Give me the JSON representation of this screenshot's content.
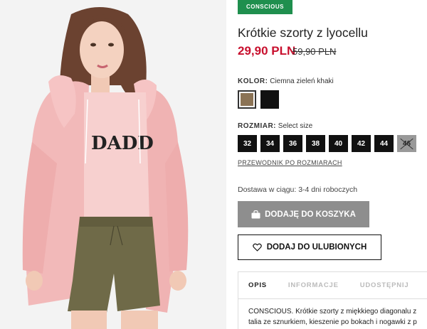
{
  "badge": "CONSCIOUS",
  "product": {
    "title": "Krótkie szorty z lyocellu",
    "price": "29,90 PLN",
    "old_price": "59,90 PLN",
    "image_print": "DADD"
  },
  "color": {
    "label": "KOLOR:",
    "value": "Ciemna zieleń khaki",
    "swatches": [
      {
        "name": "Ciemna zieleń khaki",
        "hex": "#8b7355",
        "selected": true
      },
      {
        "name": "black",
        "hex": "#111111",
        "selected": false
      }
    ]
  },
  "size": {
    "label": "ROZMIAR:",
    "value": "Select size",
    "options": [
      "32",
      "34",
      "36",
      "38",
      "40",
      "42",
      "44",
      "46"
    ],
    "unavailable": [
      "46"
    ]
  },
  "size_guide": "PRZEWODNIK PO ROZMIARACH",
  "delivery": "Dostawa w ciągu: 3-4 dni roboczych",
  "buttons": {
    "add_to_cart": "DODAJĘ DO KOSZYKA",
    "add_to_favorites": "DODAJ DO ULUBIONYCH"
  },
  "tabs": [
    "OPIS",
    "INFORMACJE",
    "UDOSTĘPNIJ"
  ],
  "description": [
    "CONSCIOUS. Krótkie szorty z miękkiego diagonalu z",
    "talia ze sznurkiem, kieszenie po bokach i nogawki z p"
  ],
  "colors": {
    "badge": "#1f8f4e",
    "price": "#c8102e",
    "cart_button": "#8e8e8e"
  },
  "icons": [
    "bag-icon",
    "heart-icon"
  ]
}
